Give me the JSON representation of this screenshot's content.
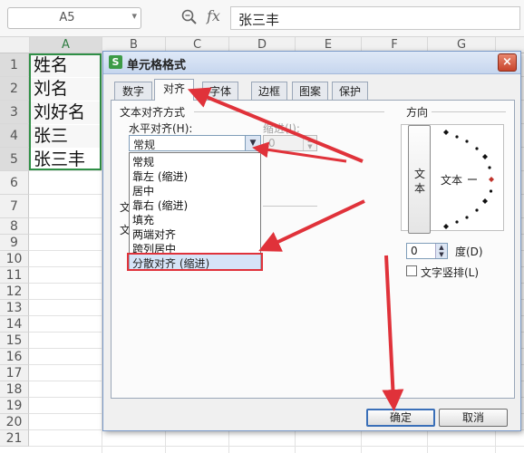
{
  "formula_bar": {
    "name_box": "A5",
    "fx_label": "fx",
    "formula_value": "张三丰",
    "icons": {
      "zoom": "zoom-magnifier-icon",
      "dropdown": "chevron-down-icon"
    }
  },
  "sheet": {
    "columns": [
      "A",
      "B",
      "C",
      "D",
      "E",
      "F",
      "G"
    ],
    "rows": [
      "1",
      "2",
      "3",
      "4",
      "5",
      "6",
      "7",
      "8",
      "9",
      "10",
      "11",
      "12",
      "13",
      "14",
      "15",
      "16",
      "17",
      "18",
      "19",
      "20",
      "21"
    ],
    "cells_a": [
      "姓名",
      "刘名",
      "刘好名",
      "张三",
      "张三丰"
    ],
    "selection_color": "#2f8f46"
  },
  "dialog": {
    "title": "单元格格式",
    "app_icon_text": "S",
    "close_symbol": "×",
    "tabs": [
      "数字",
      "对齐",
      "字体",
      "边框",
      "图案",
      "保护"
    ],
    "active_tab": "对齐",
    "text_align_group": "文本对齐方式",
    "horizontal_label": "水平对齐(H):",
    "horizontal_value": "常规",
    "indent_label": "缩进(I):",
    "indent_value": "0",
    "horizontal_options": [
      "常规",
      "靠左 (缩进)",
      "居中",
      "靠右 (缩进)",
      "填充",
      "两端对齐",
      "跨列居中",
      "分散对齐 (缩进)"
    ],
    "highlighted_option": "分散对齐 (缩进)",
    "partial_labels": {
      "vertical_prefix": "文",
      "control_prefix": "文"
    },
    "direction": {
      "group_label": "方向",
      "vertical_text_chars": [
        "文",
        "本"
      ],
      "orientation_text": "文本",
      "degree_value": "0",
      "degree_label": "度(D)",
      "vertical_checkbox_label": "文字竖排(L)",
      "vertical_checked": false
    },
    "buttons": {
      "ok": "确定",
      "cancel": "取消"
    }
  },
  "annotations": {
    "arrow_color": "#e0323a",
    "highlight_color": "#e0323a",
    "arrow_targets": [
      "tab-alignment",
      "horizontal-dropdown-arrow",
      "option-distributed",
      "ok-button"
    ]
  }
}
